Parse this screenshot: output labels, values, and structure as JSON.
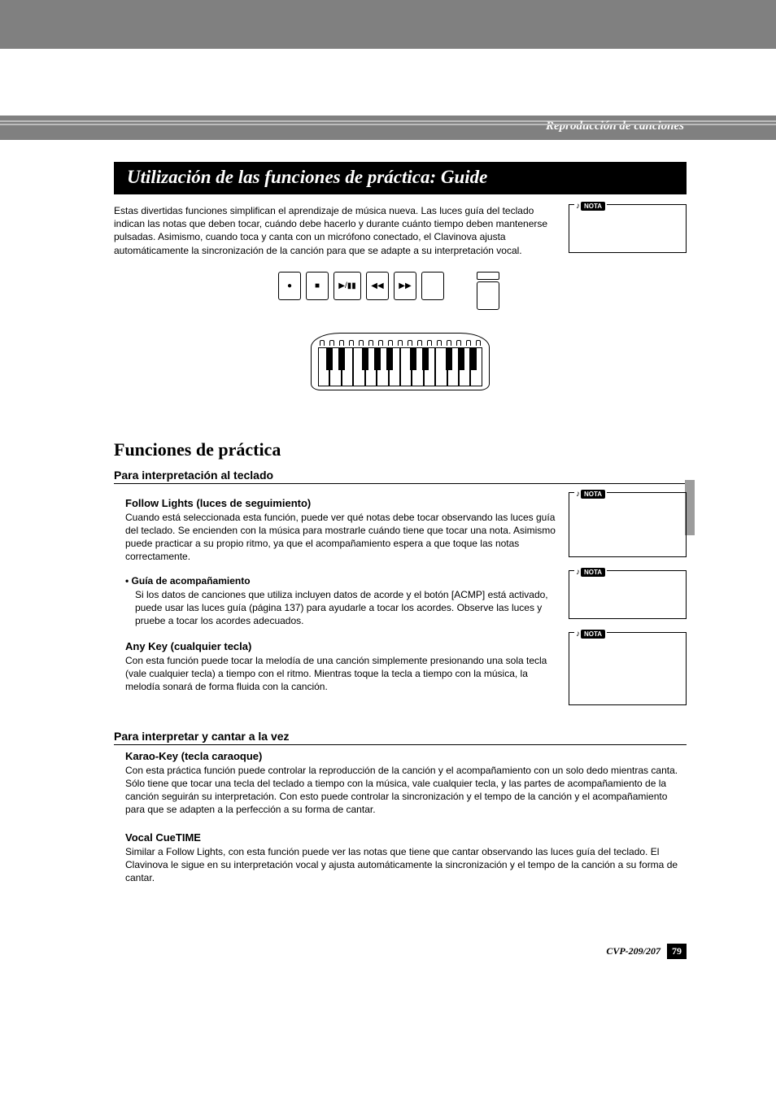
{
  "header": {
    "section": "Reproducción de canciones"
  },
  "title": "Utilización de las funciones de práctica: Guide",
  "intro": "Estas divertidas funciones simplifican el aprendizaje de música nueva. Las luces guía del teclado indican las notas que deben tocar, cuándo debe hacerlo y durante cuánto tiempo deben mantenerse pulsadas. Asimismo, cuando toca y canta con un micrófono conectado, el Clavinova ajusta automáticamente la sincronización de la canción para que se adapte a su interpretación vocal.",
  "nota_label": "NOTA",
  "practice": {
    "heading": "Funciones de práctica",
    "keyboard_heading": "Para interpretación al teclado",
    "follow_lights": {
      "title": "Follow Lights (luces de seguimiento)",
      "body": "Cuando está seleccionada esta función, puede ver qué notas debe tocar observando las luces guía del teclado. Se encienden con la música para mostrarle cuándo tiene que tocar una nota. Asimismo puede practicar a su propio ritmo, ya que el acompañamiento espera a que toque las notas correctamente."
    },
    "accomp": {
      "title": "• Guía de acompañamiento",
      "body": "Si los datos de canciones que utiliza incluyen datos de acorde y el botón [ACMP] está activado, puede usar las luces guía (página 137) para ayudarle a tocar los acordes. Observe las luces y pruebe a tocar los acordes adecuados."
    },
    "any_key": {
      "title": "Any Key (cualquier tecla)",
      "body": "Con esta función puede tocar la melodía de una canción simplemente presionando una sola tecla (vale cualquier tecla) a tiempo con el ritmo. Mientras toque la tecla a tiempo con la música, la melodía sonará de forma fluida con la canción."
    },
    "sing_heading": "Para interpretar y cantar a la vez",
    "karao": {
      "title": "Karao-Key (tecla caraoque)",
      "body": "Con esta práctica función puede controlar la reproducción de la canción y el acompañamiento con un solo dedo mientras canta. Sólo tiene que tocar una tecla del teclado a tiempo con la música, vale cualquier tecla, y las partes de acompañamiento de la canción seguirán su interpretación. Con esto puede controlar la sincronización y el tempo de la canción y el acompañamiento para que se adapten a la perfección a su forma de cantar."
    },
    "vocal": {
      "title": "Vocal CueTIME",
      "body": "Similar a Follow Lights, con esta función puede ver las notas que tiene que cantar observando las luces guía del teclado. El Clavinova le sigue en su interpretación vocal y ajusta automáticamente la sincronización y el tempo de la canción a su forma de cantar."
    }
  },
  "footer": {
    "model": "CVP-209/207",
    "page": "79"
  }
}
